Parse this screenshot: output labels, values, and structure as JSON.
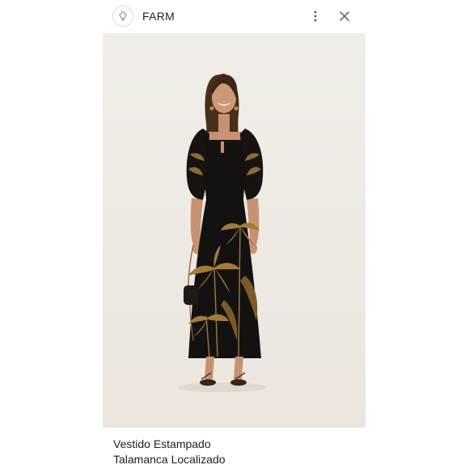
{
  "header": {
    "brand": "FARM",
    "icons": {
      "logo": "flower-logo-icon",
      "more": "more-vertical-icon",
      "close": "close-icon"
    }
  },
  "product": {
    "title_line1": "Vestido Estampado",
    "title_line2": "Talamanca Localizado"
  },
  "colors": {
    "background": "#efeae4",
    "dress": "#141210",
    "print": "#a07a3c"
  }
}
